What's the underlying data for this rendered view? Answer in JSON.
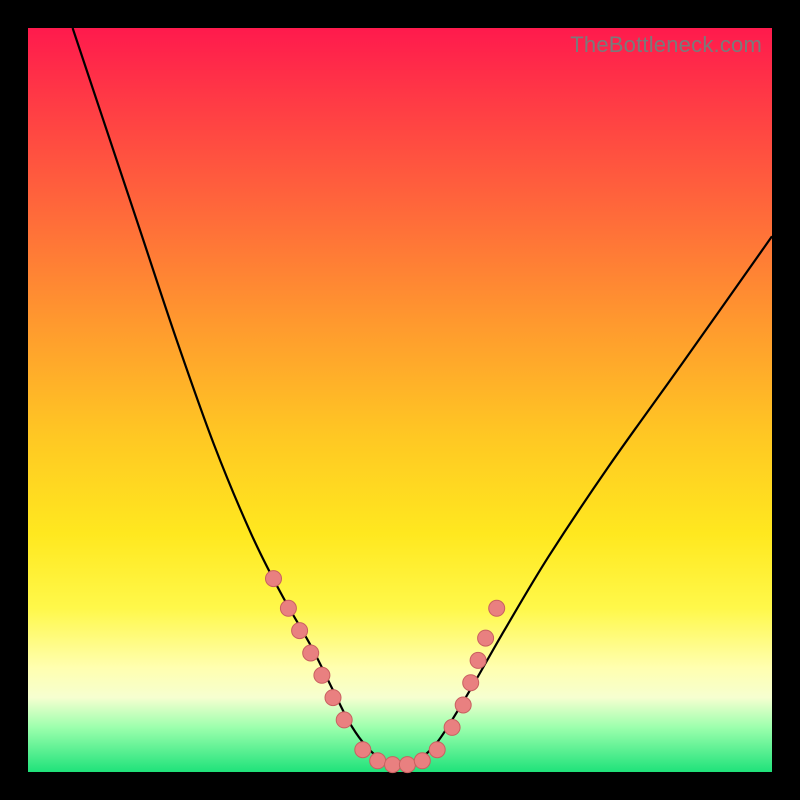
{
  "watermark": "TheBottleneck.com",
  "colors": {
    "frame": "#000000",
    "gradient_top": "#ff1a4d",
    "gradient_bottom": "#1fe27a",
    "curve": "#000000",
    "marker_fill": "#e98080",
    "marker_stroke": "#c96060"
  },
  "chart_data": {
    "type": "line",
    "title": "",
    "xlabel": "",
    "ylabel": "",
    "xlim": [
      0,
      100
    ],
    "ylim": [
      0,
      100
    ],
    "note": "No axes or tick labels are rendered; values are normalized 0–100 estimated from pixel positions. y=0 is the bottom (green) edge, y=100 is the top (red) edge.",
    "series": [
      {
        "name": "curve",
        "x": [
          6,
          10,
          15,
          20,
          25,
          30,
          34,
          38,
          41,
          43,
          45,
          47,
          49,
          51,
          53,
          55,
          57,
          60,
          64,
          70,
          78,
          88,
          100
        ],
        "y": [
          100,
          88,
          73,
          58,
          44,
          32,
          24,
          17,
          11,
          7,
          4,
          2,
          1,
          1,
          2,
          4,
          7,
          12,
          19,
          29,
          41,
          55,
          72
        ]
      }
    ],
    "markers": {
      "name": "highlighted-points",
      "x": [
        33,
        35,
        36.5,
        38,
        39.5,
        41,
        42.5,
        45,
        47,
        49,
        51,
        53,
        55,
        57,
        58.5,
        59.5,
        60.5,
        61.5,
        63
      ],
      "y": [
        26,
        22,
        19,
        16,
        13,
        10,
        7,
        3,
        1.5,
        1,
        1,
        1.5,
        3,
        6,
        9,
        12,
        15,
        18,
        22
      ]
    }
  }
}
